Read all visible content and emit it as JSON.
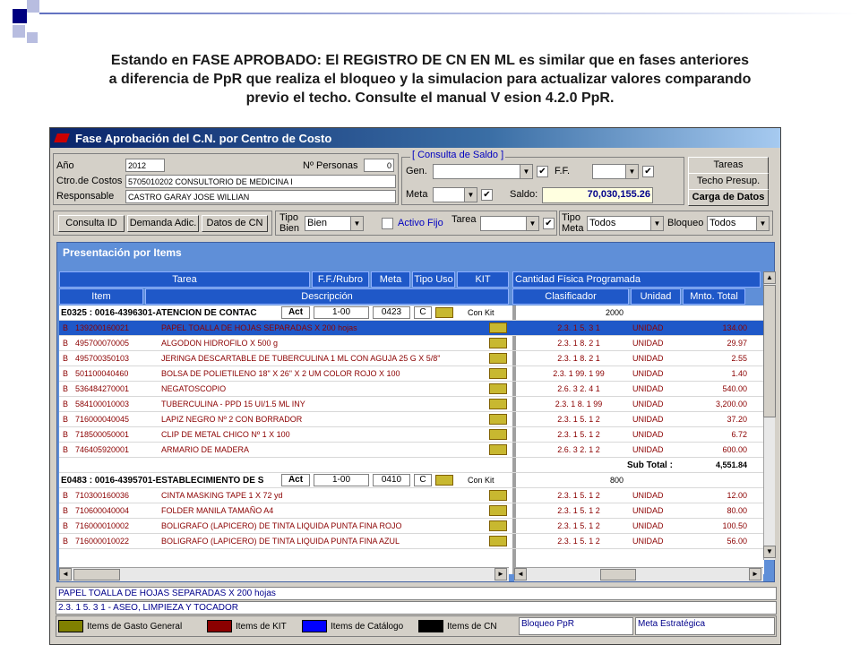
{
  "slide": {
    "title_lines": [
      "Estando en FASE APROBADO:  El REGISTRO DE CN EN ML es similar que en fases anteriores",
      "a diferencia de PpR que realiza  el bloqueo y la simulacion para actualizar valores comparando",
      "previo el techo.  Consulte el manual V esion 4.2.0 PpR."
    ]
  },
  "window": {
    "title": "Fase Aprobación del C.N. por Centro de Costo"
  },
  "form": {
    "anio_label": "Año",
    "anio_value": "2012",
    "personas_label": "Nº Personas",
    "personas_value": "0",
    "ctro_label": "Ctro.de Costos",
    "ctro_value": "5705010202  CONSULTORIO DE MEDICINA I",
    "resp_label": "Responsable",
    "resp_value": "CASTRO GARAY JOSE WILLIAN"
  },
  "saldo": {
    "group_title": "[ Consulta de Saldo ]",
    "gen_label": "Gen.",
    "ff_label": "F.F.",
    "meta_label": "Meta",
    "saldo_label": "Saldo:",
    "saldo_value": "70,030,155.26"
  },
  "buttons": {
    "tareas": "Tareas",
    "techo": "Techo Presup.",
    "carga": "Carga de Datos"
  },
  "toolbar": {
    "consulta_id": "Consulta ID",
    "demanda": "Demanda Adic.",
    "datos_cn": "Datos de CN",
    "tipo_bien_label_1": "Tipo",
    "tipo_bien_label_2": "Bien",
    "tipo_bien_value": "Bien",
    "activo_fijo": "Activo Fijo",
    "tarea_label": "Tarea",
    "tipo_meta_label_1": "Tipo",
    "tipo_meta_label_2": "Meta",
    "tipo_meta_value": "Todos",
    "bloqueo_label": "Bloqueo",
    "bloqueo_value": "Todos"
  },
  "presentacion": {
    "title": "Presentación por Items",
    "headers_top": [
      "Tarea",
      "F.F./Rubro",
      "Meta",
      "Tipo Uso",
      "KIT",
      "Cantidad Física Programada"
    ],
    "headers_sub": [
      "Item",
      "Descripción",
      "Clasificador",
      "Unidad",
      "Mnto. Total"
    ],
    "group1": {
      "label": "E0325 : 0016-4396301-ATENCION DE CONTAC",
      "act": "Act",
      "ff": "1-00",
      "meta": "0423",
      "tipo": "C",
      "kit": "Con Kit",
      "cant": "2000"
    },
    "group2": {
      "label": "E0483 : 0016-4395701-ESTABLECIMIENTO DE S",
      "act": "Act",
      "ff": "1-00",
      "meta": "0410",
      "tipo": "C",
      "kit": "Con Kit",
      "cant": "800"
    },
    "items1": [
      {
        "t": "B",
        "code": "139200160021",
        "desc": "PAPEL TOALLA DE HOJAS SEPARADAS X 200 hojas",
        "clas": "2.3. 1  5. 3  1",
        "unid": "UNIDAD",
        "monto": "134.00"
      },
      {
        "t": "B",
        "code": "495700070005",
        "desc": "ALGODON HIDROFILO X 500 g",
        "clas": "2.3. 1  8. 2  1",
        "unid": "UNIDAD",
        "monto": "29.97"
      },
      {
        "t": "B",
        "code": "495700350103",
        "desc": "JERINGA DESCARTABLE DE TUBERCULINA 1 ML CON AGUJA 25 G X 5/8\"",
        "clas": "2.3. 1  8. 2  1",
        "unid": "UNIDAD",
        "monto": "2.55"
      },
      {
        "t": "B",
        "code": "501100040460",
        "desc": "BOLSA DE POLIETILENO 18\" X 26\" X 2 UM COLOR ROJO X 100",
        "clas": "2.3. 1 99. 1 99",
        "unid": "UNIDAD",
        "monto": "1.40"
      },
      {
        "t": "B",
        "code": "536484270001",
        "desc": "NEGATOSCOPIO",
        "clas": "2.6. 3  2. 4  1",
        "unid": "UNIDAD",
        "monto": "540.00"
      },
      {
        "t": "B",
        "code": "584100010003",
        "desc": "TUBERCULINA - PPD 15 UI/1.5 ML INY",
        "clas": "2.3. 1  8. 1 99",
        "unid": "UNIDAD",
        "monto": "3,200.00"
      },
      {
        "t": "B",
        "code": "716000040045",
        "desc": "LAPIZ NEGRO Nº 2 CON BORRADOR",
        "clas": "2.3. 1  5. 1  2",
        "unid": "UNIDAD",
        "monto": "37.20"
      },
      {
        "t": "B",
        "code": "718500050001",
        "desc": "CLIP DE METAL CHICO Nº 1 X 100",
        "clas": "2.3. 1  5. 1  2",
        "unid": "UNIDAD",
        "monto": "6.72"
      },
      {
        "t": "B",
        "code": "746405920001",
        "desc": "ARMARIO DE MADERA",
        "clas": "2.6. 3  2. 1  2",
        "unid": "UNIDAD",
        "monto": "600.00"
      }
    ],
    "subtotal_label": "Sub Total :",
    "subtotal_value": "4,551.84",
    "items2": [
      {
        "t": "B",
        "code": "710300160036",
        "desc": "CINTA MASKING TAPE 1  X 72 yd",
        "clas": "2.3. 1  5. 1  2",
        "unid": "UNIDAD",
        "monto": "12.00"
      },
      {
        "t": "B",
        "code": "710600040004",
        "desc": "FOLDER MANILA TAMAÑO A4",
        "clas": "2.3. 1  5. 1  2",
        "unid": "UNIDAD",
        "monto": "80.00"
      },
      {
        "t": "B",
        "code": "716000010002",
        "desc": "BOLIGRAFO (LAPICERO) DE TINTA LIQUIDA PUNTA FINA ROJO",
        "clas": "2.3. 1  5. 1  2",
        "unid": "UNIDAD",
        "monto": "100.50"
      },
      {
        "t": "B",
        "code": "716000010022",
        "desc": "BOLIGRAFO (LAPICERO) DE TINTA LIQUIDA PUNTA FINA AZUL",
        "clas": "2.3. 1  5. 1  2",
        "unid": "UNIDAD",
        "monto": "56.00"
      }
    ]
  },
  "info": {
    "line1": "PAPEL TOALLA DE HOJAS SEPARADAS X 200 hojas",
    "line2": "2.3. 1  5. 3  1 - ASEO, LIMPIEZA Y TOCADOR"
  },
  "legend": {
    "items": [
      {
        "label": "Items de Gasto General",
        "color": "#808000"
      },
      {
        "label": "Items de KIT",
        "color": "#8b0000"
      },
      {
        "label": "Items de  Catálogo",
        "color": "#0000ff"
      },
      {
        "label": "Items de CN",
        "color": "#000000"
      }
    ],
    "bloqueo": "Bloqueo PpR",
    "meta_estr": "Meta Estratégica"
  }
}
